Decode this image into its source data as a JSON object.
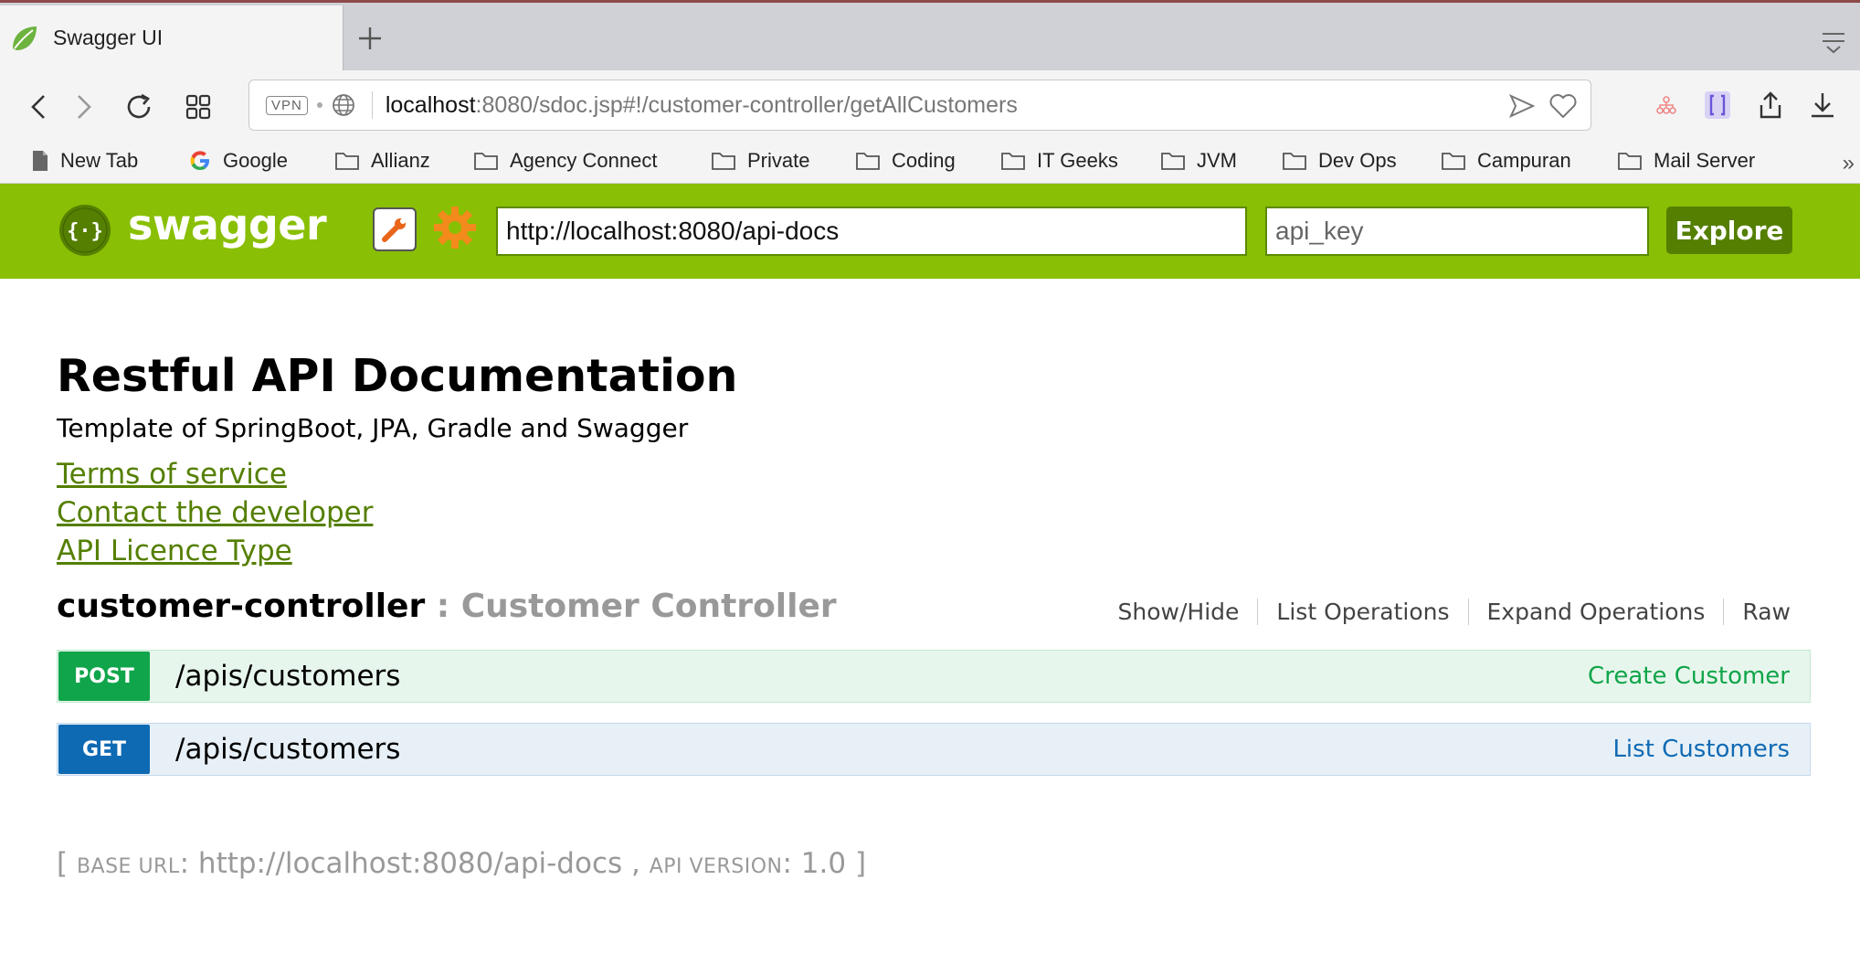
{
  "browser": {
    "tab_title": "Swagger UI",
    "url_host": "localhost",
    "url_rest": ":8080/sdoc.jsp#!/customer-controller/getAllCustomers",
    "vpn_label": "VPN",
    "bookmarks": [
      {
        "label": "New Tab",
        "icon": "page-icon"
      },
      {
        "label": "Google",
        "icon": "google-icon"
      },
      {
        "label": "Allianz",
        "icon": "folder-icon"
      },
      {
        "label": "Agency Connect",
        "icon": "folder-icon"
      },
      {
        "label": "Private",
        "icon": "folder-icon"
      },
      {
        "label": "Coding",
        "icon": "folder-icon"
      },
      {
        "label": "IT Geeks",
        "icon": "folder-icon"
      },
      {
        "label": "JVM",
        "icon": "folder-icon"
      },
      {
        "label": "Dev Ops",
        "icon": "folder-icon"
      },
      {
        "label": "Campuran",
        "icon": "folder-icon"
      },
      {
        "label": "Mail Server",
        "icon": "folder-icon"
      }
    ],
    "more_label": "»"
  },
  "swagger": {
    "brand": "swagger",
    "api_url": "http://localhost:8080/api-docs",
    "api_key_placeholder": "api_key",
    "explore_label": "Explore",
    "accent_color": "#89bf04"
  },
  "doc": {
    "title": "Restful API Documentation",
    "description": "Template of SpringBoot, JPA, Gradle and Swagger",
    "links": [
      "Terms of service",
      "Contact the developer",
      "API Licence Type"
    ]
  },
  "controller": {
    "name": "customer-controller",
    "separator": " : ",
    "description": "Customer Controller",
    "actions": [
      "Show/Hide",
      "List Operations",
      "Expand Operations",
      "Raw"
    ],
    "operations": [
      {
        "method": "POST",
        "path": "/apis/customers",
        "summary": "Create Customer",
        "color": "#10a54a"
      },
      {
        "method": "GET",
        "path": "/apis/customers",
        "summary": "List Customers",
        "color": "#0f6ab4"
      }
    ]
  },
  "footer": {
    "open": "[ ",
    "base_url_label": "BASE URL",
    "base_url": "http://localhost:8080/api-docs",
    "sep": " , ",
    "api_version_label": "API VERSION",
    "api_version": "1.0",
    "close": " ]"
  }
}
